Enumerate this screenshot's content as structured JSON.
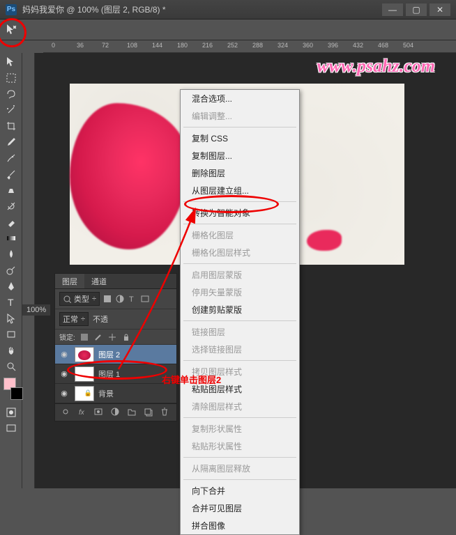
{
  "titlebar": {
    "app": "Ps",
    "title": "妈妈我爱你 @ 100% (图层 2, RGB/8) *",
    "min": "—",
    "max": "▢",
    "close": "✕"
  },
  "watermark": "www.psahz.com",
  "zoom": "100%",
  "ruler_ticks": [
    "0",
    "36",
    "72",
    "108",
    "144",
    "180",
    "216",
    "252",
    "288",
    "324",
    "360",
    "396",
    "432",
    "468",
    "504"
  ],
  "layers_panel": {
    "tabs": {
      "layers": "图层",
      "channels": "通道"
    },
    "kind": "类型",
    "blend_mode": "正常",
    "opacity_label": "不透",
    "lock_label": "锁定:",
    "layers": [
      {
        "name": "图层 2",
        "selected": true,
        "thumb": "flower"
      },
      {
        "name": "图层 1",
        "selected": false,
        "thumb": "white"
      },
      {
        "name": "背景",
        "selected": false,
        "thumb": "white",
        "locked": true
      }
    ]
  },
  "context_menu": {
    "items": [
      {
        "label": "混合选项...",
        "enabled": true
      },
      {
        "label": "编辑调整...",
        "enabled": false
      },
      {
        "sep": true
      },
      {
        "label": "复制 CSS",
        "enabled": true
      },
      {
        "label": "复制图层...",
        "enabled": true
      },
      {
        "label": "删除图层",
        "enabled": true
      },
      {
        "label": "从图层建立组...",
        "enabled": true
      },
      {
        "sep": true
      },
      {
        "label": "转换为智能对象",
        "enabled": true
      },
      {
        "sep": true
      },
      {
        "label": "栅格化图层",
        "enabled": false
      },
      {
        "label": "栅格化图层样式",
        "enabled": false
      },
      {
        "sep": true
      },
      {
        "label": "启用图层蒙版",
        "enabled": false
      },
      {
        "label": "停用矢量蒙版",
        "enabled": false
      },
      {
        "label": "创建剪贴蒙版",
        "enabled": true
      },
      {
        "sep": true
      },
      {
        "label": "链接图层",
        "enabled": false
      },
      {
        "label": "选择链接图层",
        "enabled": false
      },
      {
        "sep": true
      },
      {
        "label": "拷贝图层样式",
        "enabled": false
      },
      {
        "label": "粘贴图层样式",
        "enabled": true
      },
      {
        "label": "清除图层样式",
        "enabled": false
      },
      {
        "sep": true
      },
      {
        "label": "复制形状属性",
        "enabled": false
      },
      {
        "label": "粘贴形状属性",
        "enabled": false
      },
      {
        "sep": true
      },
      {
        "label": "从隔离图层释放",
        "enabled": false
      },
      {
        "sep": true
      },
      {
        "label": "向下合并",
        "enabled": true
      },
      {
        "label": "合并可见图层",
        "enabled": true
      },
      {
        "label": "拼合图像",
        "enabled": true
      }
    ]
  },
  "annotation": "右键单击图层2"
}
